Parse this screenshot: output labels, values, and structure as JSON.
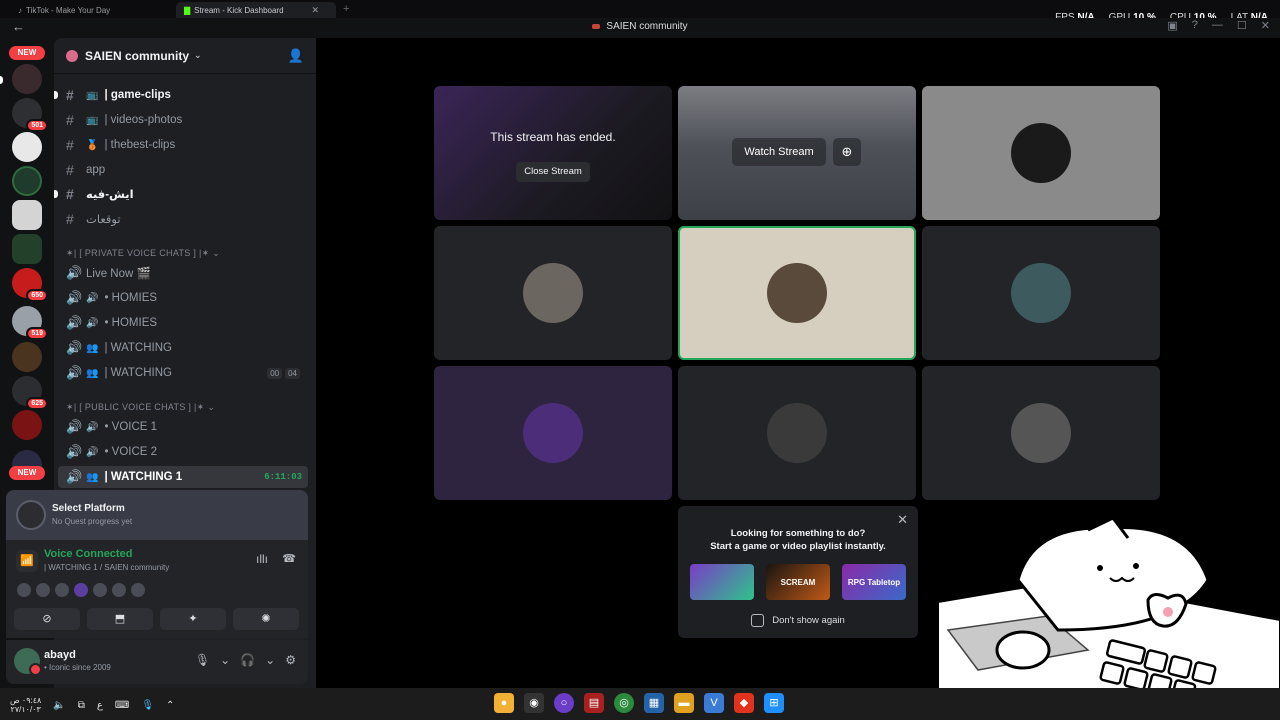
{
  "browser": {
    "tabs": [
      {
        "label": "TikTok - Make Your Day"
      },
      {
        "label": "Stream - Kick Dashboard"
      }
    ],
    "tab_close": "✕",
    "new_tab": "+",
    "perf": {
      "fps_label": "FPS",
      "fps_value": "N/A",
      "gpu_label": "GPU",
      "gpu_value": "10 %",
      "cpu_label": "CPU",
      "cpu_value": "10 %",
      "lat_label": "LAT",
      "lat_value": "N/A"
    }
  },
  "titlebar": {
    "title": "SAIEN community"
  },
  "rail": {
    "new_top": "NEW",
    "new_bottom": "NEW",
    "badges": [
      "501",
      "650",
      "519",
      "625"
    ]
  },
  "server": {
    "name": "SAIEN community"
  },
  "channels": {
    "text": [
      {
        "name": "| game-clips",
        "emoji": "📺"
      },
      {
        "name": "| videos-photos",
        "emoji": "📺"
      },
      {
        "name": "| thebest-clips",
        "emoji": "🥉"
      },
      {
        "name": "app",
        "emoji": ""
      },
      {
        "name": "ايش-فيه",
        "emoji": ""
      },
      {
        "name": "توقعات",
        "emoji": ""
      }
    ],
    "private_category": "✶| [ PRIVATE VOICE CHATS ] |✶",
    "private_voice": [
      {
        "name": "Live Now 🎬",
        "emoji": ""
      },
      {
        "name": "• HOMIES",
        "emoji": "🔊"
      },
      {
        "name": "• HOMIES",
        "emoji": "🔊"
      },
      {
        "name": "| WATCHING",
        "emoji": "👥"
      },
      {
        "name": "| WATCHING",
        "emoji": "👥",
        "count_a": "00",
        "count_b": "04"
      }
    ],
    "public_category": "✶| [ PUBLIC VOICE CHATS ] |✶",
    "public_voice": [
      {
        "name": "• VOICE 1",
        "emoji": "🔊"
      },
      {
        "name": "• VOICE 2",
        "emoji": "🔊"
      },
      {
        "name": "| WATCHING 1",
        "emoji": "👥",
        "timer": "6:11:03"
      }
    ]
  },
  "quest": {
    "title": "Select Platform",
    "subtitle": "No Quest progress yet"
  },
  "voice": {
    "status": "Voice Connected",
    "channel": "| WATCHING 1 / SAIEN community"
  },
  "user": {
    "name": "abayd",
    "status": "• Iconic since 2009"
  },
  "stage": {
    "ended_msg": "This stream has ended.",
    "close_stream": "Close Stream",
    "watch_stream": "Watch Stream"
  },
  "activity": {
    "line1": "Looking for something to do?",
    "line2": "Start a game or video playlist instantly.",
    "cards": [
      "",
      "SCREAM",
      "RPG Tabletop"
    ],
    "dont_show": "Don't show again"
  },
  "taskbar": {
    "clock_time": "٠٩:٤٨ ص",
    "clock_date": "٢٧/١٠/٠٣",
    "lang": "ع"
  },
  "colors": {
    "accent_green": "#23a55a",
    "badge_red": "#f23f43",
    "bg_dark": "#1e1f22"
  }
}
